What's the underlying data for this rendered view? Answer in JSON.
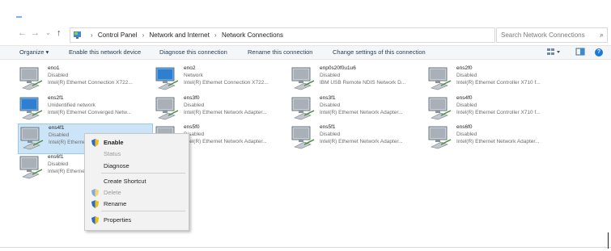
{
  "nav": {
    "back_icon": "←",
    "forward_icon": "→",
    "dropdown_icon": "⌄",
    "up_icon": "↑",
    "breadcrumbs": [
      "Control Panel",
      "Network and Internet",
      "Network Connections"
    ],
    "separator": "›",
    "refresh_icon": "↻",
    "search_placeholder": "Search Network Connections",
    "search_icon": "⌕"
  },
  "toolbar": {
    "organize": "Organize ▾",
    "enable": "Enable this network device",
    "diagnose": "Diagnose this connection",
    "rename": "Rename this connection",
    "change_settings": "Change settings of this connection"
  },
  "connections": [
    {
      "name": "eno1",
      "status": "Disabled",
      "adapter": "Intel(R) Ethernet Connection X722...",
      "state": "disabled"
    },
    {
      "name": "eno2",
      "status": "Network",
      "adapter": "Intel(R) Ethernet Connection X722...",
      "state": "connected"
    },
    {
      "name": "enp0s20f0u1u6",
      "status": "Disabled",
      "adapter": "IBM USB Remote NDIS Network D...",
      "state": "disabled"
    },
    {
      "name": "ens2f0",
      "status": "Disabled",
      "adapter": "Intel(R) Ethernet Controller X710 f...",
      "state": "disabled"
    },
    {
      "name": "ens2f1",
      "status": "Unidentified network",
      "adapter": "Intel(R) Ethernet Converged Netw...",
      "state": "connected"
    },
    {
      "name": "ens3f0",
      "status": "Disabled",
      "adapter": "Intel(R) Ethernet Network Adapter...",
      "state": "disabled"
    },
    {
      "name": "ens3f1",
      "status": "Disabled",
      "adapter": "Intel(R) Ethernet Network Adapter...",
      "state": "disabled"
    },
    {
      "name": "ens4f0",
      "status": "Disabled",
      "adapter": "Intel(R) Ethernet Controller X710 f...",
      "state": "disabled"
    },
    {
      "name": "ens4f1",
      "status": "Disabled",
      "adapter": "Intel(R) Ethernet Network Adapter...",
      "state": "disabled",
      "selected": true
    },
    {
      "name": "ens5f0",
      "status": "Disabled",
      "adapter": "Intel(R) Ethernet Network Adapter...",
      "state": "disabled"
    },
    {
      "name": "ens5f1",
      "status": "Disabled",
      "adapter": "Intel(R) Ethernet Network Adapter...",
      "state": "disabled"
    },
    {
      "name": "ens6f0",
      "status": "Disabled",
      "adapter": "Intel(R) Ethernet Network Adapter...",
      "state": "disabled"
    },
    {
      "name": "ens6f1",
      "status": "Disabled",
      "adapter": "Intel(R) Ethernet Network Adapter...",
      "state": "disabled"
    }
  ],
  "context_menu": {
    "enable": "Enable",
    "status": "Status",
    "diagnose": "Diagnose",
    "create_shortcut": "Create Shortcut",
    "delete": "Delete",
    "rename": "Rename",
    "properties": "Properties"
  },
  "colors": {
    "selection": "#cce4f7",
    "accent": "#1a7ad8"
  }
}
